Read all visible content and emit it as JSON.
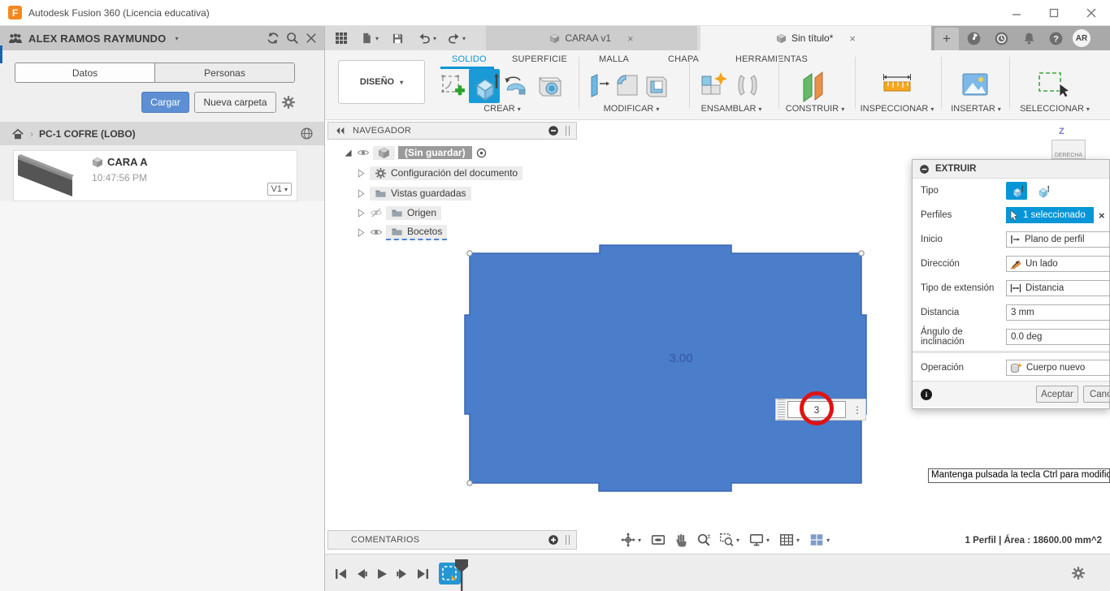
{
  "window": {
    "logo": "F",
    "title": "Autodesk Fusion 360 (Licencia educativa)"
  },
  "icons": {
    "caret": "▾",
    "close": "×",
    "plus": "+",
    "kebab": "⋮",
    "chevron": "›"
  },
  "panel": {
    "user": "ALEX RAMOS RAYMUNDO",
    "tab_data": "Datos",
    "tab_people": "Personas",
    "upload": "Cargar",
    "new_folder": "Nueva carpeta",
    "breadcrumb": "PC-1 COFRE (LOBO)",
    "item": {
      "name": "CARA A",
      "time": "10:47:56 PM",
      "version": "V1"
    }
  },
  "appbar": {
    "tab1": "CARAA v1",
    "tab2": "Sin título*",
    "avatar": "AR"
  },
  "ribbon": {
    "workspace": "DISEÑO",
    "tabs": [
      "SOLIDO",
      "SUPERFICIE",
      "MALLA",
      "CHAPA",
      "HERRAMIENTAS"
    ],
    "groups": [
      "CREAR",
      "MODIFICAR",
      "ENSAMBLAR",
      "CONSTRUIR",
      "INSPECCIONAR",
      "INSERTAR",
      "SELECCIONAR"
    ]
  },
  "navigator": {
    "title": "NAVEGADOR",
    "root": "(Sin guardar)",
    "items": [
      "Configuración del documento",
      "Vistas guardadas",
      "Origen",
      "Bocetos"
    ]
  },
  "viewcube": {
    "axis": "Z",
    "face": "DERECHA"
  },
  "canvas": {
    "extrude_label": "3.00",
    "manipulator_value": "3"
  },
  "dialog": {
    "title": "EXTRUIR",
    "labels": {
      "type": "Tipo",
      "profiles": "Perfiles",
      "start": "Inicio",
      "direction": "Dirección",
      "extent_type": "Tipo de extensión",
      "distance": "Distancia",
      "taper": "Ángulo de inclinación",
      "operation": "Operación"
    },
    "values": {
      "profiles": "1 seleccionado",
      "start": "Plano de perfil",
      "direction": "Un lado",
      "extent_type": "Distancia",
      "distance": "3 mm",
      "taper": "0.0 deg",
      "operation": "Cuerpo nuevo"
    },
    "ok": "Aceptar",
    "cancel": "Cancelar"
  },
  "tooltip": "Mantenga pulsada la tecla Ctrl para modificar l",
  "comments": {
    "title": "COMENTARIOS"
  },
  "status": "1 Perfil | Área : 18600.00 mm^2",
  "colors": {
    "accent": "#0696d7",
    "shape_fill": "#4a7dca",
    "highlight_red": "#e01313",
    "upload_blue": "#5e8fd2"
  }
}
